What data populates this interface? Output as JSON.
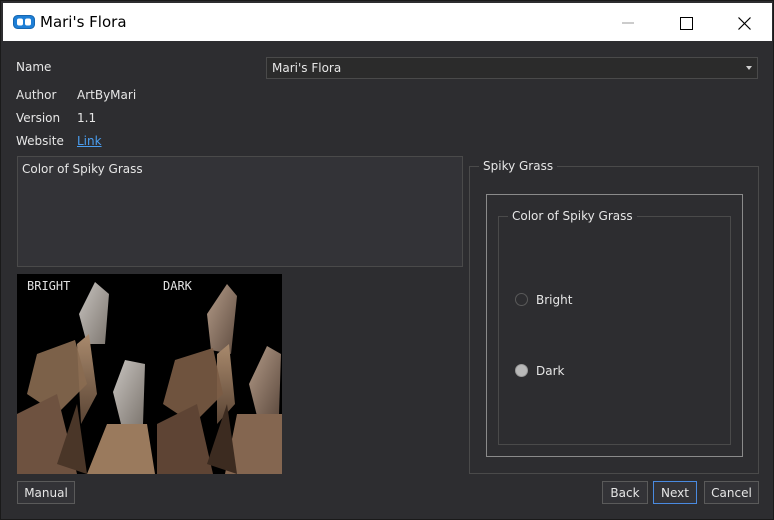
{
  "window": {
    "title": "Mari's Flora",
    "controls": {
      "minimize": "minimize-icon",
      "maximize": "maximize-icon",
      "close": "close-icon"
    }
  },
  "info": {
    "name_label": "Name",
    "name_value": "Mari's Flora",
    "author_label": "Author",
    "author_value": "ArtByMari",
    "version_label": "Version",
    "version_value": "1.1",
    "website_label": "Website",
    "website_link": "Link"
  },
  "description": "Color of Spiky Grass",
  "preview": {
    "left_caption": "BRIGHT",
    "right_caption": "DARK"
  },
  "options": {
    "group_title": "Spiky Grass",
    "subgroup_title": "Color of Spiky Grass",
    "choices": [
      {
        "label": "Bright",
        "selected": false
      },
      {
        "label": "Dark",
        "selected": true
      }
    ]
  },
  "buttons": {
    "manual": "Manual",
    "back": "Back",
    "next": "Next",
    "cancel": "Cancel"
  },
  "colors": {
    "background": "#2d2d30",
    "link": "#4a9ef0",
    "focus": "#4a8ae0"
  }
}
